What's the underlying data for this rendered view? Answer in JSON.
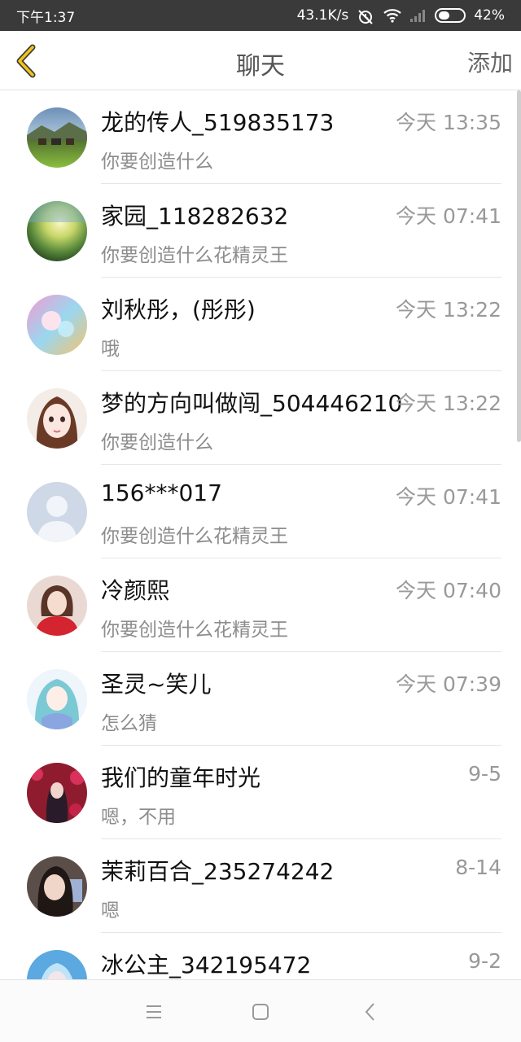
{
  "status_bar": {
    "time": "下午1:37",
    "network_speed": "43.1K/s",
    "battery": "42%",
    "battery_level": 0.42,
    "icons": [
      "alarm-off-icon",
      "wifi-icon",
      "signal-icon",
      "battery-icon"
    ]
  },
  "header": {
    "back_icon": "chevron-left-icon",
    "title": "聊天",
    "add_label": "添加",
    "accent_color": "#f0c419"
  },
  "conversations": [
    {
      "name": "龙的传人_519835173",
      "time": "今天 13:35",
      "preview": "你要创造什么",
      "avatar": "landscape-photo"
    },
    {
      "name": "家园_118282632",
      "time": "今天 07:41",
      "preview": "你要创造什么花精灵王",
      "avatar": "sunset-field-photo"
    },
    {
      "name": "刘秋彤，(彤彤)",
      "time": "今天 13:22",
      "preview": "哦",
      "avatar": "anime-colorful"
    },
    {
      "name": "梦的方向叫做闯_504446210",
      "time": "今天 13:22",
      "preview": "你要创造什么",
      "avatar": "illustrated-girl"
    },
    {
      "name": "156***017",
      "time": "今天 07:41",
      "preview": "你要创造什么花精灵王",
      "avatar": "default-user"
    },
    {
      "name": "冷颜熙",
      "time": "今天 07:40",
      "preview": "你要创造什么花精灵王",
      "avatar": "girl-red-sweater"
    },
    {
      "name": "圣灵~笑儿",
      "time": "今天 07:39",
      "preview": "怎么猜",
      "avatar": "anime-blue"
    },
    {
      "name": "我们的童年时光",
      "time": "9-5",
      "preview": "嗯，不用",
      "avatar": "girl-flowers"
    },
    {
      "name": "茉莉百合_235274242",
      "time": "8-14",
      "preview": "嗯",
      "avatar": "girl-dark-hair"
    },
    {
      "name": "冰公主_342195472",
      "time": "9-2",
      "preview": "",
      "avatar": "ice-princess"
    }
  ],
  "nav_bar": {
    "buttons": [
      "menu-icon",
      "home-icon",
      "back-icon"
    ]
  }
}
